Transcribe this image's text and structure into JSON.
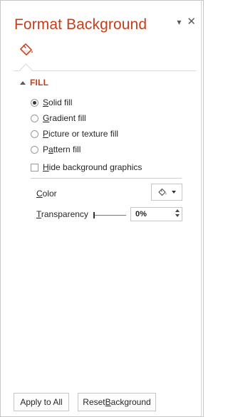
{
  "pane": {
    "title": "Format Background",
    "options_icon": "dropdown-caret-icon",
    "close_icon": "close-icon"
  },
  "tab": {
    "icon": "fill-bucket-icon"
  },
  "section": {
    "label": "FILL"
  },
  "fill_options": [
    {
      "label_pre": "",
      "label_u": "S",
      "label_post": "olid fill",
      "selected": true
    },
    {
      "label_pre": "",
      "label_u": "G",
      "label_post": "radient fill",
      "selected": false
    },
    {
      "label_pre": "",
      "label_u": "P",
      "label_post": "icture or texture fill",
      "selected": false
    },
    {
      "label_pre": "P",
      "label_u": "a",
      "label_post": "ttern fill",
      "selected": false
    }
  ],
  "hide_graphics": {
    "label_pre": "",
    "label_u": "H",
    "label_post": "ide background graphics",
    "checked": false
  },
  "color": {
    "label_u": "C",
    "label_post": "olor"
  },
  "transparency": {
    "label_u": "T",
    "label_post": "ransparency",
    "value": "0%"
  },
  "buttons": {
    "apply_pre": "Apply to All",
    "reset_pre": "Reset ",
    "reset_u": "B",
    "reset_post": "ackground"
  },
  "colors": {
    "accent": "#c43e1c",
    "text": "#262626"
  }
}
